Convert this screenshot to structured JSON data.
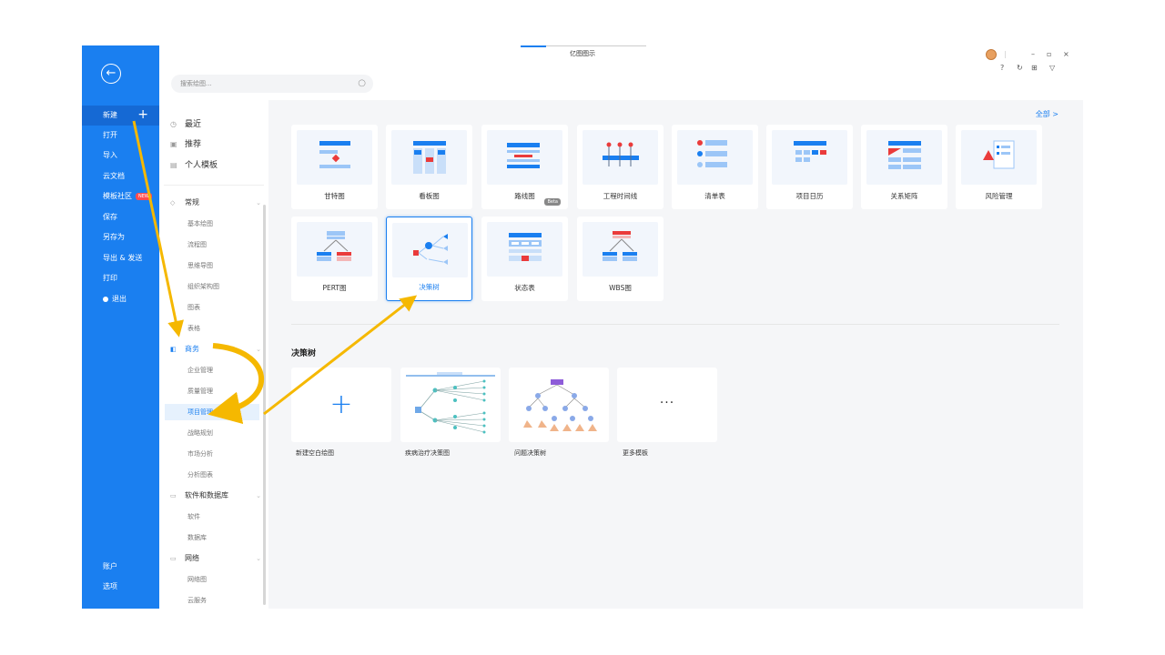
{
  "app_title": "亿图图示",
  "search": {
    "placeholder": "搜索绘图..."
  },
  "leftbar": {
    "items": [
      {
        "label": "新建"
      },
      {
        "label": "打开"
      },
      {
        "label": "导入"
      },
      {
        "label": "云文档"
      },
      {
        "label": "模板社区",
        "badge": "NEW"
      },
      {
        "label": "保存"
      },
      {
        "label": "另存为"
      },
      {
        "label": "导出 & 发送"
      },
      {
        "label": "打印"
      },
      {
        "label": "退出"
      }
    ],
    "bottom": [
      {
        "label": "账户"
      },
      {
        "label": "选项"
      }
    ]
  },
  "categories": {
    "top": [
      {
        "label": "最近"
      },
      {
        "label": "推荐"
      },
      {
        "label": "个人模板"
      }
    ],
    "groups": [
      {
        "label": "常规",
        "subs": [
          "基本绘图",
          "流程图",
          "思维导图",
          "组织架构图",
          "图表",
          "表格"
        ]
      },
      {
        "label": "商务",
        "subs": [
          "企业管理",
          "质量管理",
          "项目管理",
          "战略规划",
          "市场分析",
          "分析图表"
        ]
      },
      {
        "label": "软件和数据库",
        "subs": [
          "软件",
          "数据库"
        ]
      },
      {
        "label": "网络",
        "subs": [
          "网络图",
          "云服务"
        ]
      }
    ]
  },
  "main": {
    "view_all": "全部 >",
    "diagram_types": [
      {
        "label": "甘特图"
      },
      {
        "label": "看板图"
      },
      {
        "label": "路线图",
        "badge": "Beta"
      },
      {
        "label": "工程时间线"
      },
      {
        "label": "清单表"
      },
      {
        "label": "项目日历"
      },
      {
        "label": "关系矩阵"
      },
      {
        "label": "风险管理"
      },
      {
        "label": "PERT图"
      },
      {
        "label": "决策树"
      },
      {
        "label": "状态表"
      },
      {
        "label": "WBS图"
      }
    ],
    "section_title": "决策树",
    "templates": [
      {
        "label": "新建空白绘图"
      },
      {
        "label": "疾病治疗决策图"
      },
      {
        "label": "问题决策树"
      },
      {
        "label": "更多模板"
      }
    ]
  },
  "colors": {
    "accent": "#1a7ff0",
    "sidebar": "#1a7ff0",
    "arrow": "#f5b800"
  }
}
